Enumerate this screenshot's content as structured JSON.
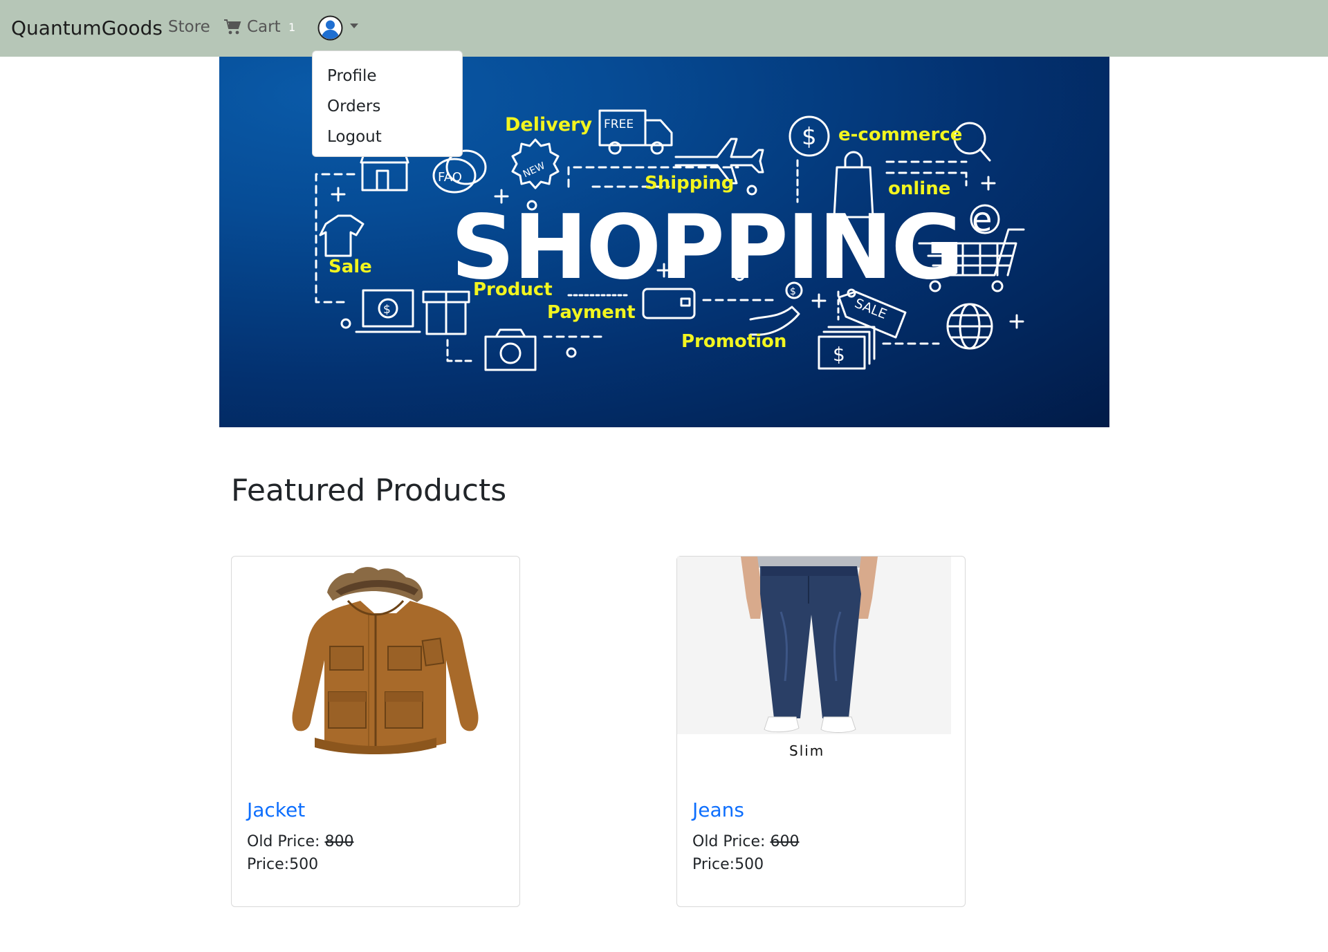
{
  "nav": {
    "brand": "QuantumGoods",
    "store_label": "Store",
    "cart_label": "Cart",
    "cart_count": "1",
    "user_menu": [
      "Profile",
      "Orders",
      "Logout"
    ]
  },
  "hero": {
    "words": {
      "main": "SHOPPING",
      "delivery": "Delivery",
      "free": "FREE",
      "shipping": "Shipping",
      "ecommerce": "e-commerce",
      "online": "online",
      "faq": "FAQ",
      "new": "NEW",
      "sale": "Sale",
      "product": "Product",
      "payment": "Payment",
      "promotion": "Promotion",
      "sale_tag": "SALE",
      "e": "e",
      "dollar": "$"
    }
  },
  "featured": {
    "title": "Featured Products",
    "products": [
      {
        "name": "Jacket",
        "old_price_label": "Old Price:",
        "old_price": "800",
        "price_label": "Price:500"
      },
      {
        "name": "Jeans",
        "old_price_label": "Old Price:",
        "old_price": "600",
        "price_label": "Price:500",
        "image_caption": "Slim"
      }
    ]
  },
  "colors": {
    "navbar_bg": "#b6c6b7",
    "hero_bg": "#033170",
    "hero_accent": "#f2f51f",
    "link": "#0d6efd",
    "jacket": "#a86a2a",
    "jeans": "#2a3f66"
  }
}
